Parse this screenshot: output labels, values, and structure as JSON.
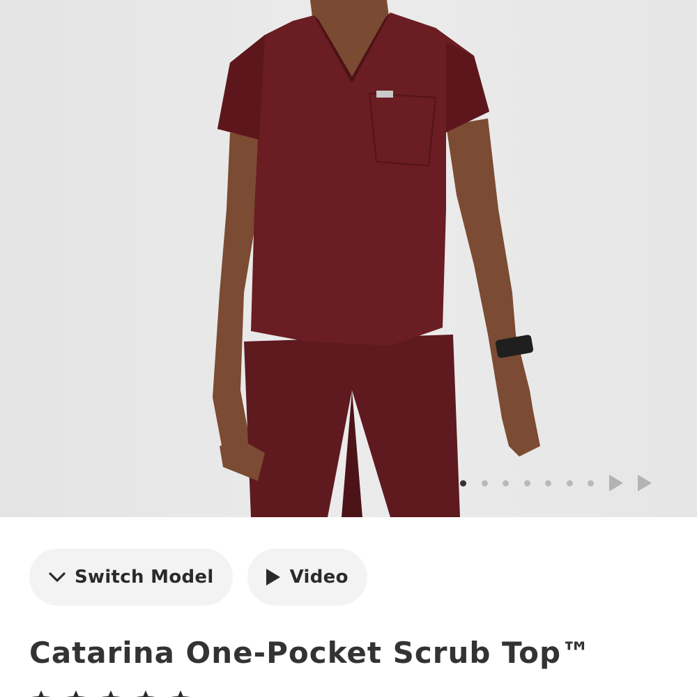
{
  "gallery": {
    "image_alt": "Model wearing burgundy scrub top and pants",
    "slide_count": 7,
    "active_slide": 1
  },
  "actions": {
    "switch_model_label": "Switch Model",
    "video_label": "Video"
  },
  "product": {
    "title": "Catarina One-Pocket Scrub Top™"
  },
  "rating": {
    "stars": 5
  },
  "colors": {
    "scrub": "#6a1d22",
    "background": "#e9e9e9",
    "pill": "#f3f3f3"
  }
}
